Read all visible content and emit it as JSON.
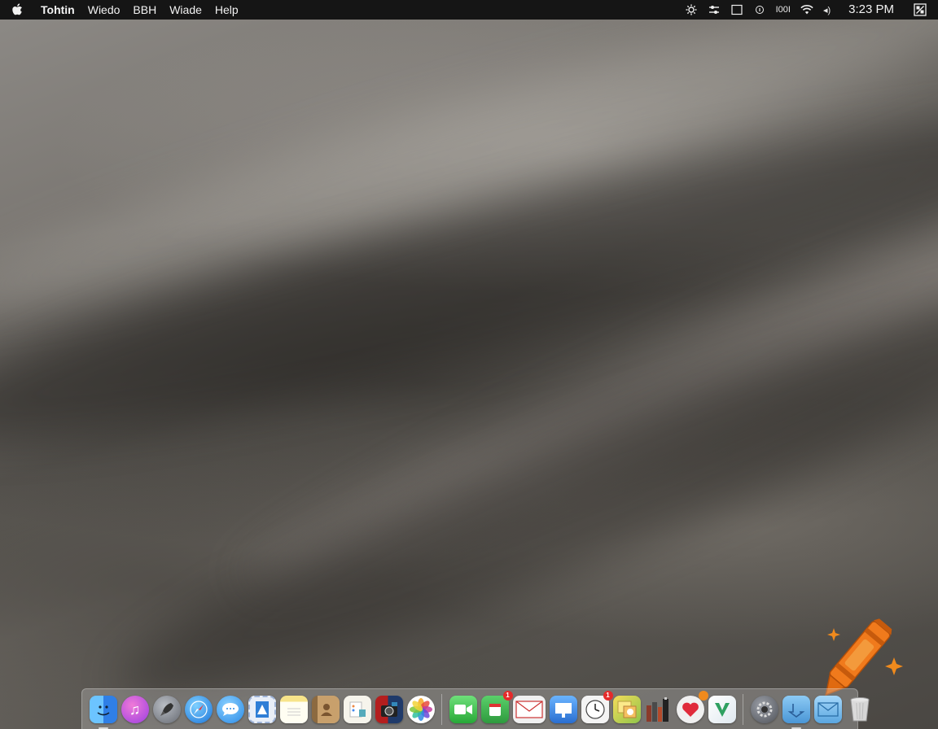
{
  "menubar": {
    "apple_icon": "apple-logo-icon",
    "items": [
      {
        "label": "Tohtin",
        "bold": true
      },
      {
        "label": "Wiedo"
      },
      {
        "label": "BBH"
      },
      {
        "label": "Wiade"
      },
      {
        "label": "Help"
      }
    ],
    "status": {
      "icons": [
        "gear-sun-icon",
        "sliders-icon",
        "display-icon",
        "info-circle-icon"
      ],
      "bars_text": "I00I",
      "wifi_icon": "wifi-icon",
      "volume_text": "◂)",
      "clock": "3:23 PM",
      "control_icon": "control-center-icon"
    }
  },
  "dock": {
    "apps": [
      {
        "name": "finder",
        "icon": "finder-icon",
        "color": "#2f8ff0",
        "running": true
      },
      {
        "name": "music",
        "icon": "music-icon",
        "color": "#c04fe0"
      },
      {
        "name": "launchpad",
        "icon": "rocket-icon",
        "color": "#8a8f98"
      },
      {
        "name": "safari",
        "icon": "compass-icon",
        "color": "#2a8de8"
      },
      {
        "name": "messages",
        "icon": "chat-bubble-icon",
        "color": "#3ea0ef"
      },
      {
        "name": "mail-stamp",
        "icon": "stamp-icon",
        "color": "#2f7ed6"
      },
      {
        "name": "notes",
        "icon": "notes-icon",
        "color": "#f5e07a"
      },
      {
        "name": "contacts",
        "icon": "contacts-icon",
        "color": "#b08a5a"
      },
      {
        "name": "reminders",
        "icon": "reminders-icon",
        "color": "#f0f0e8"
      },
      {
        "name": "photo-booth",
        "icon": "camera-icon",
        "color": "#c02828"
      },
      {
        "name": "photos",
        "icon": "photos-icon",
        "color": "#ffffff"
      },
      {
        "name": "facetime",
        "icon": "video-icon",
        "color": "#36c04a"
      },
      {
        "name": "calendar",
        "icon": "calendar-icon",
        "color": "#3cb54a",
        "badge": "1"
      },
      {
        "name": "mail",
        "icon": "envelope-icon",
        "color": "#eaeaea"
      },
      {
        "name": "keynote",
        "icon": "presentation-icon",
        "color": "#3b86d8"
      },
      {
        "name": "clock",
        "icon": "clock-icon",
        "color": "#f2f2f2",
        "badge": "1"
      },
      {
        "name": "stickies",
        "icon": "stickies-icon",
        "color": "#e8c84a"
      },
      {
        "name": "books",
        "icon": "books-icon",
        "color": "#8b4a2a"
      },
      {
        "name": "heart-app",
        "icon": "heart-icon",
        "color": "#e8e8e8",
        "badge_orange": true
      },
      {
        "name": "vectornator",
        "icon": "vector-icon",
        "color": "#3aa060"
      }
    ],
    "right_apps": [
      {
        "name": "system-preferences",
        "icon": "gear-icon",
        "color": "#707378"
      },
      {
        "name": "downloads",
        "icon": "folder-download-icon",
        "color": "#5aa6e0",
        "running": true
      },
      {
        "name": "mail-folder",
        "icon": "mail-folder-icon",
        "color": "#6fb6ea"
      },
      {
        "name": "trash",
        "icon": "trash-icon",
        "color": "#c8c8c8"
      }
    ]
  },
  "overlay": {
    "icon": "crayon-sparkle-icon",
    "crayon_color": "#f07a1c",
    "sparkle_color": "#f08a1c"
  }
}
